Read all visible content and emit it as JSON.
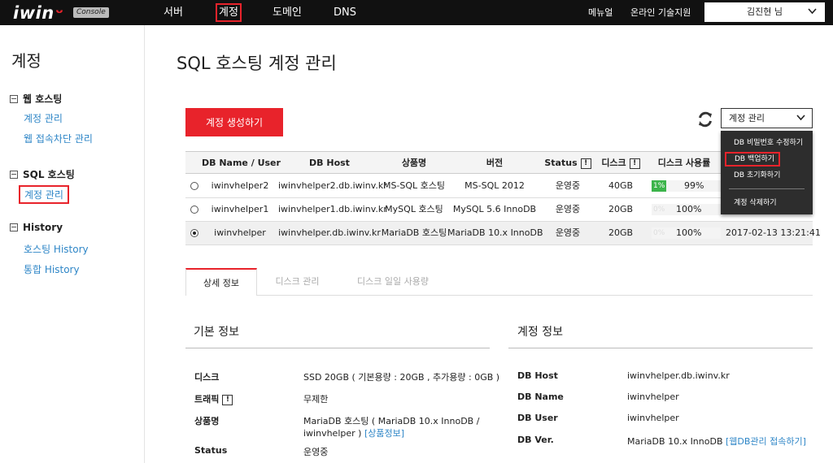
{
  "topbar": {
    "logo": "iwin",
    "logo_smile": "́",
    "console_badge": "Console",
    "nav": [
      "서버",
      "계정",
      "도메인",
      "DNS"
    ],
    "manual": "메뉴얼",
    "support": "온라인 기술지원",
    "user": "김진현 님"
  },
  "sidebar": {
    "title": "계정",
    "groups": [
      {
        "label": "웹 호스팅",
        "items": [
          "계정 관리",
          "웹 접속차단 관리"
        ]
      },
      {
        "label": "SQL 호스팅",
        "items": [
          "계정 관리"
        ]
      },
      {
        "label": "History",
        "items": [
          "호스팅 History",
          "통합 History"
        ]
      }
    ]
  },
  "main": {
    "title": "SQL 호스팅 계정 관리",
    "create_button": "계정 생성하기",
    "select_value": "계정 관리",
    "dropdown": [
      "DB 비밀번호 수정하기",
      "DB 백업하기",
      "DB 초기화하기",
      "계정 삭제하기"
    ]
  },
  "table": {
    "headers": [
      "DB Name / User",
      "DB Host",
      "상품명",
      "버전",
      "Status",
      "디스크",
      "디스크 사용률"
    ],
    "info_mark": "!",
    "rows": [
      {
        "name": "iwinvhelper2",
        "host": "iwinvhelper2.db.iwinv.kr",
        "product": "MS-SQL 호스팅",
        "version": "MS-SQL 2012",
        "status": "운영중",
        "disk": "40GB",
        "usage_pct": 1,
        "usage_label": "1%",
        "usage_text": "99%",
        "date": "",
        "selected": false
      },
      {
        "name": "iwinvhelper1",
        "host": "iwinvhelper1.db.iwinv.kr",
        "product": "MySQL 호스팅",
        "version": "MySQL 5.6 InnoDB",
        "status": "운영중",
        "disk": "20GB",
        "usage_pct": 0,
        "usage_label": "0%",
        "usage_text": "100%",
        "date": "",
        "selected": false
      },
      {
        "name": "iwinvhelper",
        "host": "iwinvhelper.db.iwinv.kr",
        "product": "MariaDB 호스팅",
        "version": "MariaDB 10.x InnoDB",
        "status": "운영중",
        "disk": "20GB",
        "usage_pct": 0,
        "usage_label": "0%",
        "usage_text": "100%",
        "date": "2017-02-13 13:21:41",
        "selected": true
      }
    ]
  },
  "tabs": [
    "상세 정보",
    "디스크 관리",
    "디스크 일일 사용량"
  ],
  "basic_info": {
    "title": "기본 정보",
    "disk_label": "디스크",
    "disk_value": "SSD 20GB ( 기본용량 : 20GB , 추가용량 : 0GB )",
    "traffic_label": "트래픽",
    "traffic_value": "무제한",
    "product_label": "상품명",
    "product_value_1": "MariaDB 호스팅 ( MariaDB 10.x InnoDB /",
    "product_value_2": "iwinvhelper )",
    "product_link": "[상품정보]",
    "status_label": "Status",
    "status_value": "운영중"
  },
  "account_info": {
    "title": "계정 정보",
    "host_label": "DB Host",
    "host_value": "iwinvhelper.db.iwinv.kr",
    "name_label": "DB Name",
    "name_value": "iwinvhelper",
    "user_label": "DB User",
    "user_value": "iwinvhelper",
    "ver_label": "DB Ver.",
    "ver_value": "MariaDB 10.x InnoDB",
    "ver_link": "[웹DB관리 접속하기]"
  },
  "colors": {
    "accent": "#e8232b",
    "link": "#2e86c7",
    "usage": "#3cb44b",
    "topbar": "#111111"
  }
}
